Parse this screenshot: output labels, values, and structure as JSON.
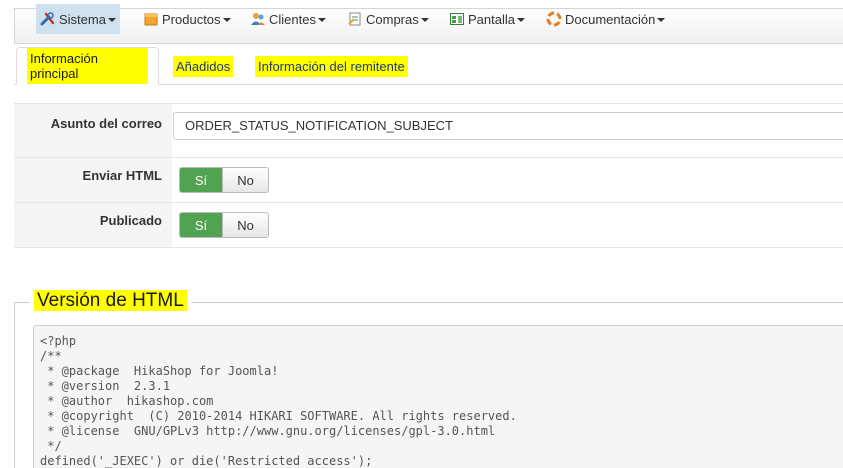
{
  "menu": {
    "items": [
      {
        "label": "Sistema",
        "icon": "tools-icon"
      },
      {
        "label": "Productos",
        "icon": "box-icon"
      },
      {
        "label": "Clientes",
        "icon": "users-icon"
      },
      {
        "label": "Compras",
        "icon": "order-icon"
      },
      {
        "label": "Pantalla",
        "icon": "display-icon"
      },
      {
        "label": "Documentación",
        "icon": "lifebuoy-icon"
      }
    ]
  },
  "tabs": [
    {
      "label": "Información principal"
    },
    {
      "label": "Añadidos"
    },
    {
      "label": "Información del remitente"
    }
  ],
  "form": {
    "subject": {
      "label": "Asunto del correo",
      "value": "ORDER_STATUS_NOTIFICATION_SUBJECT"
    },
    "send_html": {
      "label": "Enviar HTML",
      "yes": "Sí",
      "no": "No"
    },
    "published": {
      "label": "Publicado",
      "yes": "Sí",
      "no": "No"
    }
  },
  "html_version": {
    "legend": "Versión de HTML",
    "code": "<?php\n/**\n * @package  HikaShop for Joomla!\n * @version  2.3.1\n * @author  hikashop.com\n * @copyright  (C) 2010-2014 HIKARI SOFTWARE. All rights reserved.\n * @license  GNU/GPLv3 http://www.gnu.org/licenses/gpl-3.0.html\n */\ndefined('_JEXEC') or die('Restricted access');"
  },
  "colors": {
    "highlight": "#ffff00",
    "active_menu": "#cfe1ef",
    "yes_button": "#51a351"
  }
}
